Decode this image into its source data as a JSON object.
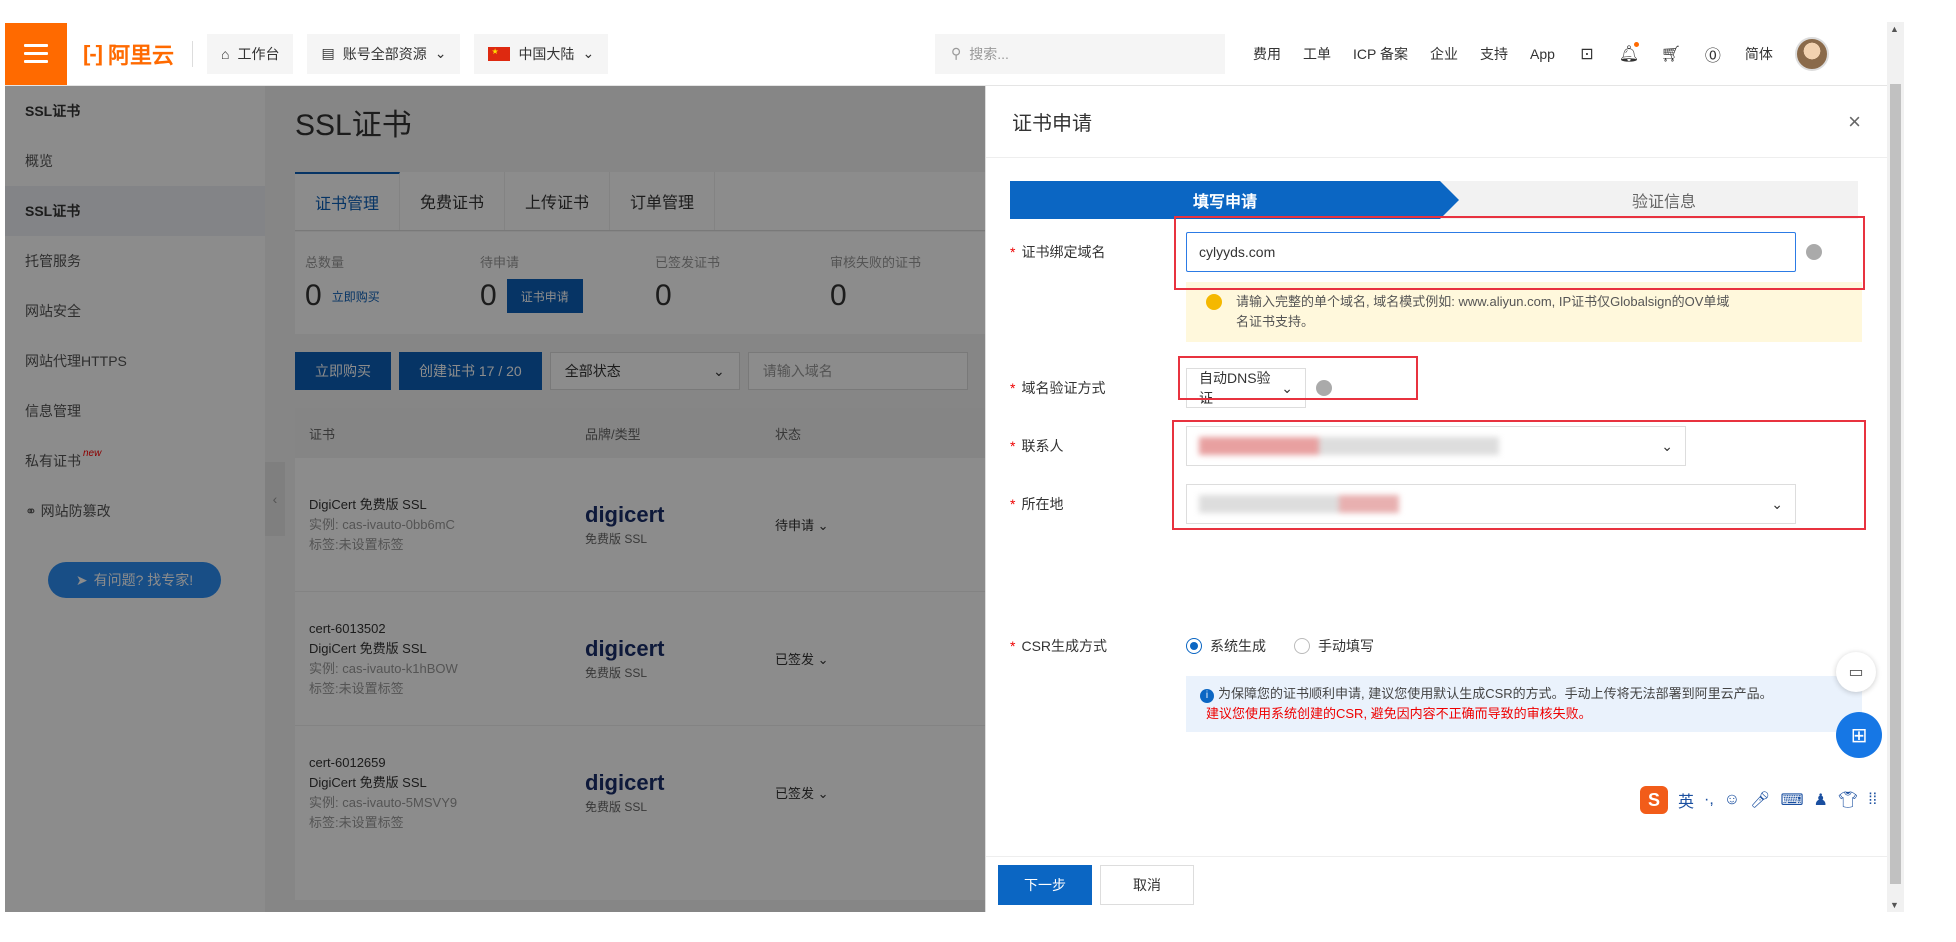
{
  "topbar": {
    "logo_text": "阿里云",
    "workbench": "工作台",
    "resources": "账号全部资源",
    "region": "中国大陆",
    "search_placeholder": "搜索...",
    "links": [
      "费用",
      "工单",
      "ICP 备案",
      "企业",
      "支持",
      "App"
    ],
    "lang": "简体"
  },
  "sidebar": {
    "title": "SSL证书",
    "items": [
      "概览",
      "SSL证书",
      "托管服务",
      "网站安全",
      "网站代理HTTPS",
      "信息管理",
      "私有证书",
      "网站防篡改"
    ],
    "new_badge": "new",
    "help_button": "有问题? 找专家!"
  },
  "main": {
    "title": "SSL证书",
    "tabs": [
      "证书管理",
      "免费证书",
      "上传证书",
      "订单管理"
    ],
    "stats": [
      {
        "label": "总数量",
        "value": "0",
        "action": "立即购买"
      },
      {
        "label": "待申请",
        "value": "0",
        "action": "证书申请"
      },
      {
        "label": "已签发证书",
        "value": "0"
      },
      {
        "label": "审核失败的证书",
        "value": "0"
      }
    ],
    "actions": {
      "buy": "立即购买",
      "create": "创建证书 17 / 20",
      "status_filter": "全部状态",
      "domain_placeholder": "请输入域名"
    },
    "columns": [
      "证书",
      "品牌/类型",
      "状态"
    ],
    "rows": [
      {
        "id": "",
        "name": "DigiCert 免费版 SSL",
        "instance": "实例: cas-ivauto-0bb6mC",
        "tag": "标签:未设置标签",
        "brand": "digicert",
        "brand_type": "免费版 SSL",
        "status": "待申请"
      },
      {
        "id": "cert-6013502",
        "name": "DigiCert 免费版 SSL",
        "instance": "实例: cas-ivauto-k1hBOW",
        "tag": "标签:未设置标签",
        "brand": "digicert",
        "brand_type": "免费版 SSL",
        "status": "已签发"
      },
      {
        "id": "cert-6012659",
        "name": "DigiCert 免费版 SSL",
        "instance": "实例: cas-ivauto-5MSVY9",
        "tag": "标签:未设置标签",
        "brand": "digicert",
        "brand_type": "免费版 SSL",
        "status": "已签发"
      }
    ]
  },
  "drawer": {
    "title": "证书申请",
    "steps": [
      "填写申请",
      "验证信息"
    ],
    "domain_label": "证书绑定域名",
    "domain_value": "cylyyds.com",
    "domain_tip_line1": "请输入完整的单个域名, 域名模式例如: www.aliyun.com, IP证书仅Globalsign的OV单域",
    "domain_tip_line2": "名证书支持。",
    "verify_label": "域名验证方式",
    "verify_value": "自动DNS验证",
    "contact_label": "联系人",
    "location_label": "所在地",
    "csr_label": "CSR生成方式",
    "csr_options": [
      "系统生成",
      "手动填写"
    ],
    "csr_info_line1": "为保障您的证书顺利申请, 建议您使用默认生成CSR的方式。手动上传将无法部署到阿里云产品。",
    "csr_info_line2": "建议您使用系统创建的CSR, 避免因内容不正确而导致的审核失败。",
    "next_button": "下一步",
    "cancel_button": "取消"
  },
  "ime": {
    "lang": "英"
  }
}
